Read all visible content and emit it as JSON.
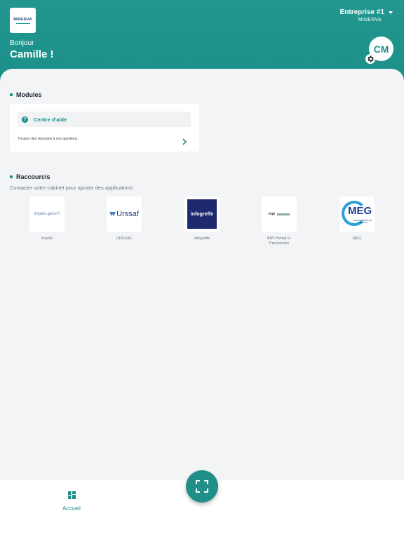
{
  "header": {
    "logo_text": "MINERVA",
    "greeting": "Bonjour",
    "user_name": "Camille !",
    "company_name": "Entreprise #1",
    "company_sub": "MINERVA",
    "avatar_initials": "CM"
  },
  "modules": {
    "title": "Modules",
    "help_label": "Centre d'aide",
    "help_description": "Trouvez des réponses à vos questions"
  },
  "shortcuts": {
    "title": "Raccourcis",
    "subtitle": "Contacter votre cabinet pour ajouter des applications",
    "items": [
      {
        "label": "Impôts",
        "logo_text": "impots.gouv.fr"
      },
      {
        "label": "URSSAF",
        "logo_text": "Urssaf"
      },
      {
        "label": "Infogreffe",
        "logo_text": "infogreffe"
      },
      {
        "label": "INPI Portail E-Procédures",
        "logo_text": "inpi"
      },
      {
        "label": "MEG",
        "logo_text": "MEG",
        "logo_sub": "MANAGEMENT EN GESTION"
      }
    ]
  },
  "bottom_nav": {
    "home_label": "Accueil"
  },
  "colors": {
    "brand": "#1f8f88",
    "header": "#22978f"
  },
  "icons": [
    "gear-icon",
    "help-icon",
    "chevron-right-icon",
    "dashboard-icon",
    "scan-icon",
    "caret-down-icon"
  ]
}
